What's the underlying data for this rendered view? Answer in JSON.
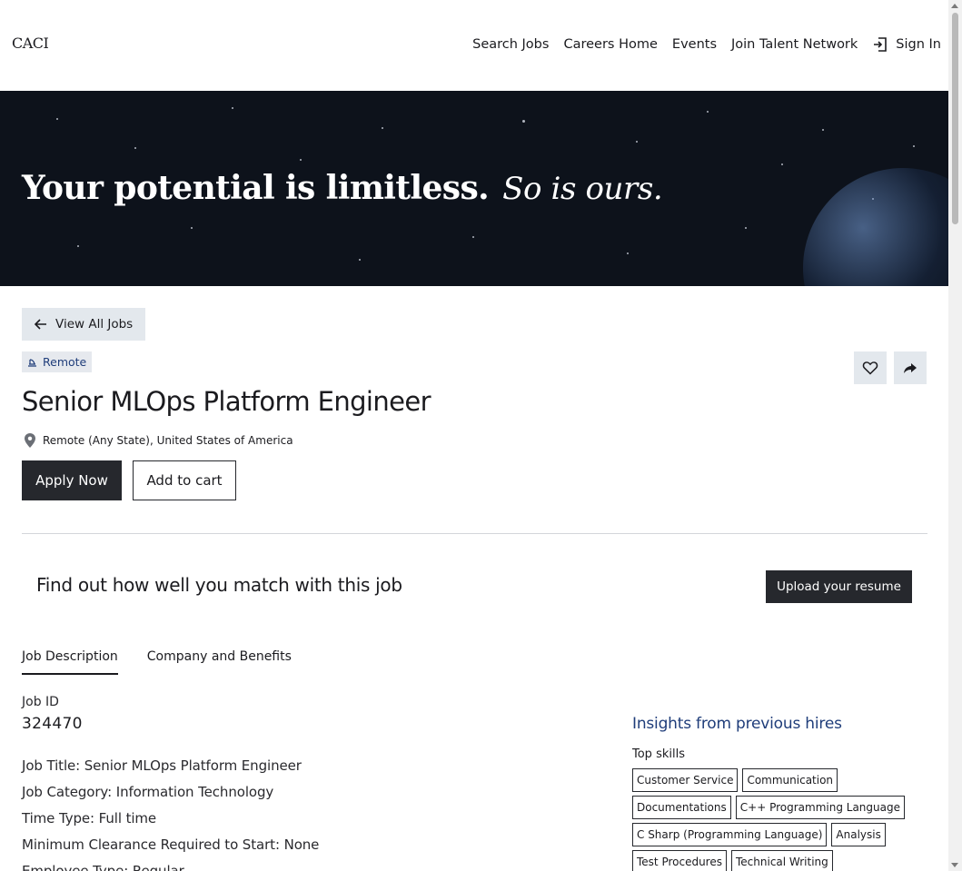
{
  "header": {
    "logo": "CACI",
    "nav": [
      "Search Jobs",
      "Careers Home",
      "Events",
      "Join Talent Network"
    ],
    "sign_in": "Sign In"
  },
  "hero": {
    "headline": "Your potential is limitless.",
    "tagline": "So is ours."
  },
  "job": {
    "back_label": "View All Jobs",
    "badge": "Remote",
    "title": "Senior MLOps Platform Engineer",
    "location": "Remote (Any State), United States of America",
    "apply_label": "Apply Now",
    "cart_label": "Add to cart",
    "favorite_icon": "heart-icon",
    "share_icon": "share-icon"
  },
  "match": {
    "text": "Find out how well you match with this job",
    "upload_label": "Upload your resume"
  },
  "tabs": [
    {
      "label": "Job Description",
      "active": true
    },
    {
      "label": "Company and Benefits",
      "active": false
    }
  ],
  "description": {
    "job_id_label": "Job ID",
    "job_id": "324470",
    "lines": [
      "Job Title: Senior MLOps Platform Engineer",
      "Job Category: Information Technology",
      "Time Type: Full time",
      "Minimum Clearance Required to Start: None",
      "Employee Type: Regular"
    ]
  },
  "insights": {
    "title": "Insights from previous hires",
    "skills_label": "Top skills",
    "skills": [
      "Customer Service",
      "Communication",
      "Documentations",
      "C++ Programming Language",
      "C Sharp (Programming Language)",
      "Analysis",
      "Test Procedures",
      "Technical Writing"
    ]
  },
  "colors": {
    "hero_bg": "#0d121b",
    "primary_button": "#26282d",
    "accent_blue": "#1f3d7a",
    "light_button": "#e3e8ed"
  }
}
